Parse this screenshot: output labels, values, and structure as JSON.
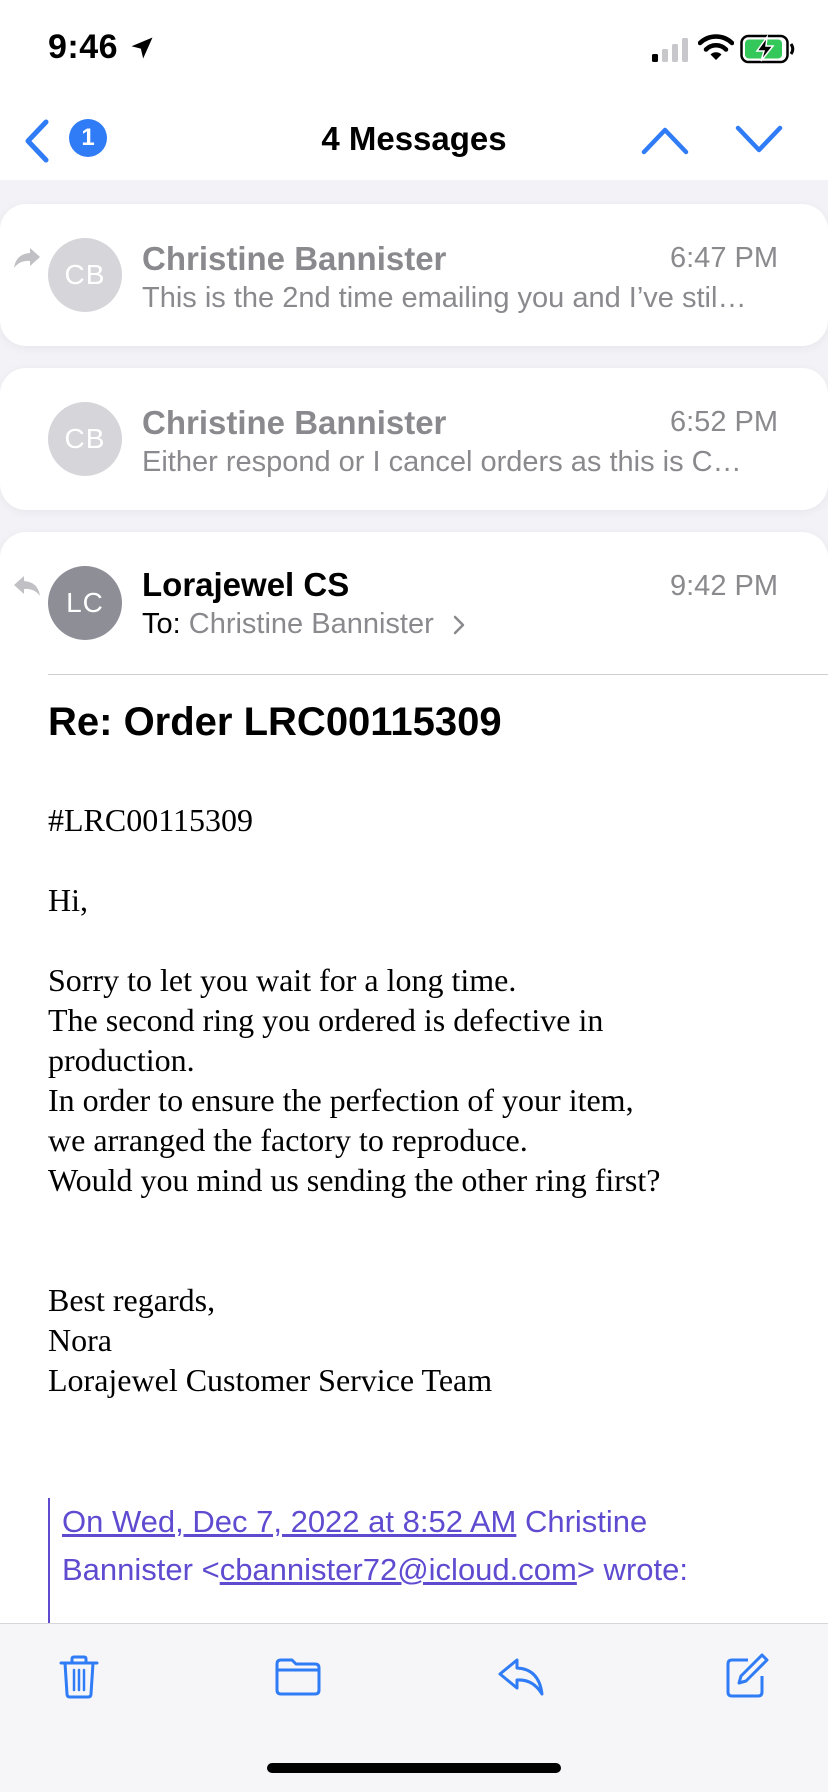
{
  "status_bar": {
    "time": "9:46",
    "icons": [
      "location-arrow-icon",
      "cellular-signal-icon",
      "wifi-icon",
      "battery-charging-icon"
    ]
  },
  "nav": {
    "unread_badge": "1",
    "title": "4 Messages",
    "icons": [
      "back-chevron-icon",
      "previous-message-icon",
      "next-message-icon"
    ]
  },
  "messages": [
    {
      "avatar_initials": "CB",
      "sender": "Christine Bannister",
      "time": "6:47 PM",
      "preview": "This is the 2nd time emailing you and I’ve stil…",
      "indicator_icon": "forwarded-icon"
    },
    {
      "avatar_initials": "CB",
      "sender": "Christine Bannister",
      "time": "6:52 PM",
      "preview": "Either respond or I cancel orders as this is C…"
    }
  ],
  "open_message": {
    "avatar_initials": "LC",
    "sender": "Lorajewel CS",
    "time": "9:42 PM",
    "to_label": "To:",
    "to_name": "Christine Bannister",
    "indicator_icon": "replied-icon",
    "subject": "Re: Order LRC00115309",
    "body_lines": [
      "#LRC00115309",
      "",
      "Hi,",
      "",
      "Sorry to let you wait for a long time.",
      "The second ring you ordered is defective in",
      "production.",
      "In order to ensure the perfection of your item,",
      "we arranged the factory to reproduce.",
      "Would you mind us sending the other ring first?",
      "",
      "",
      "Best regards,",
      "Nora",
      "Lorajewel Customer Service Team"
    ],
    "quote": {
      "date_link": "On Wed, Dec 7, 2022 at 8:52 AM",
      "name_part1": " Christine",
      "name_part2": "Bannister <",
      "email_link": "cbannister72@icloud.com",
      "suffix": "> wrote:"
    }
  },
  "toolbar": {
    "icons": [
      "trash-icon",
      "folder-icon",
      "reply-icon",
      "compose-icon"
    ]
  },
  "colors": {
    "accent": "#2f7cf6",
    "muted_text": "#8a8a8e",
    "quote": "#5e4bd0",
    "background": "#f2f2f7"
  }
}
